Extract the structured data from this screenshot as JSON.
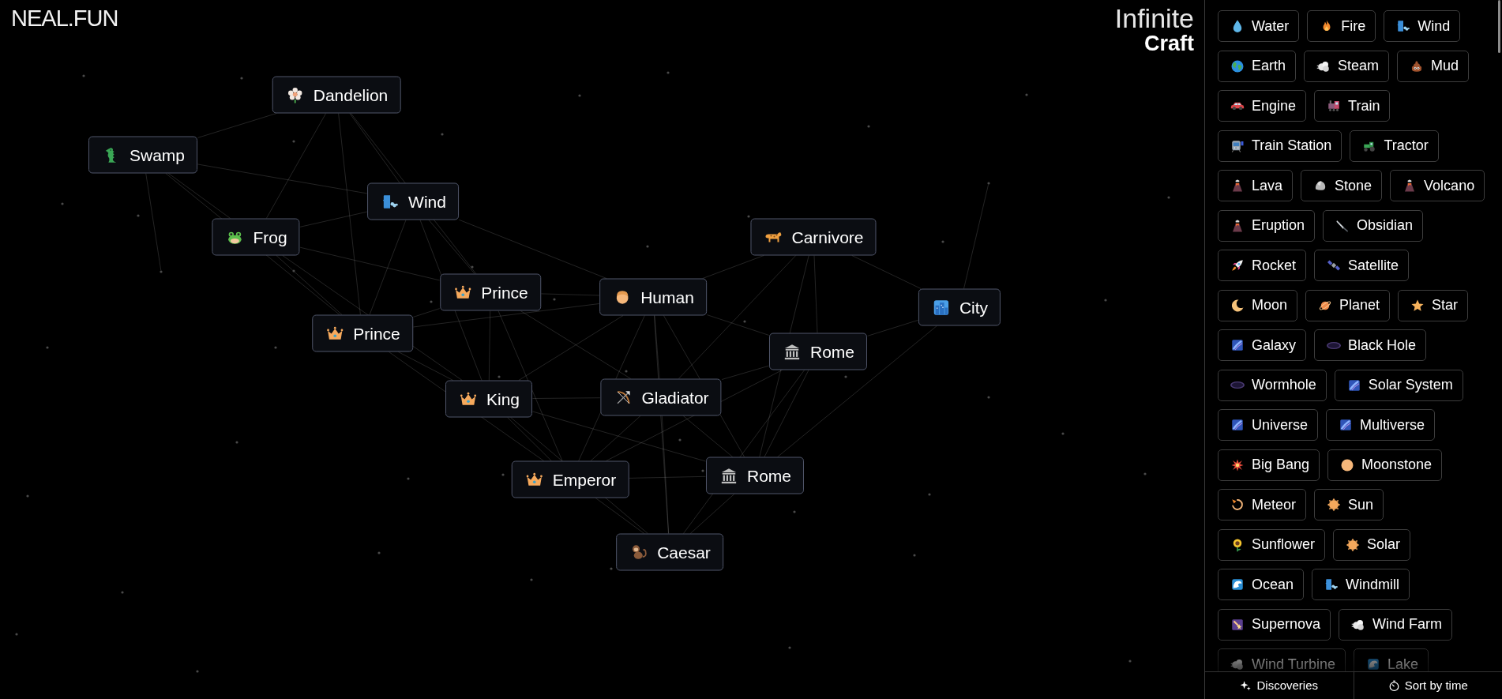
{
  "logo": {
    "text": "NEAL.FUN"
  },
  "title": {
    "top": "Infinite",
    "bottom": "Craft"
  },
  "canvas": {
    "elements": [
      {
        "label": "Dandelion",
        "kind": "flower"
      },
      {
        "label": "Swamp",
        "kind": "crocodile"
      },
      {
        "label": "Wind",
        "kind": "windface"
      },
      {
        "label": "Frog",
        "kind": "frog"
      },
      {
        "label": "Carnivore",
        "kind": "leopard"
      },
      {
        "label": "Prince",
        "kind": "crown"
      },
      {
        "label": "Human",
        "kind": "head"
      },
      {
        "label": "City",
        "kind": "city"
      },
      {
        "label": "Prince",
        "kind": "crown"
      },
      {
        "label": "Rome",
        "kind": "temple"
      },
      {
        "label": "King",
        "kind": "crown"
      },
      {
        "label": "Gladiator",
        "kind": "bow"
      },
      {
        "label": "Emperor",
        "kind": "crown"
      },
      {
        "label": "Rome",
        "kind": "temple"
      },
      {
        "label": "Caesar",
        "kind": "monkey"
      }
    ]
  },
  "sidebar": {
    "rows": [
      {
        "items": [
          {
            "label": "Water",
            "kind": "droplet"
          },
          {
            "label": "Fire",
            "kind": "flame"
          },
          {
            "label": "Wind",
            "kind": "windface"
          }
        ]
      },
      {
        "items": [
          {
            "label": "Earth",
            "kind": "globe"
          },
          {
            "label": "Steam",
            "kind": "puff"
          },
          {
            "label": "Mud",
            "kind": "poop"
          }
        ]
      },
      {
        "items": [
          {
            "label": "Engine",
            "kind": "car"
          },
          {
            "label": "Train",
            "kind": "locomotive"
          }
        ]
      },
      {
        "items": [
          {
            "label": "Train Station",
            "kind": "tram"
          },
          {
            "label": "Tractor",
            "kind": "tractor"
          }
        ]
      },
      {
        "items": [
          {
            "label": "Lava",
            "kind": "volcano"
          },
          {
            "label": "Stone",
            "kind": "rock"
          },
          {
            "label": "Volcano",
            "kind": "volcano"
          }
        ]
      },
      {
        "items": [
          {
            "label": "Eruption",
            "kind": "volcano"
          },
          {
            "label": "Obsidian",
            "kind": "knife"
          }
        ]
      },
      {
        "items": [
          {
            "label": "Rocket",
            "kind": "rocket"
          },
          {
            "label": "Satellite",
            "kind": "satellite"
          }
        ]
      },
      {
        "items": [
          {
            "label": "Moon",
            "kind": "moon"
          },
          {
            "label": "Planet",
            "kind": "planet"
          },
          {
            "label": "Star",
            "kind": "star"
          }
        ]
      },
      {
        "items": [
          {
            "label": "Galaxy",
            "kind": "galaxy"
          },
          {
            "label": "Black Hole",
            "kind": "hole"
          }
        ]
      },
      {
        "items": [
          {
            "label": "Wormhole",
            "kind": "hole"
          },
          {
            "label": "Solar System",
            "kind": "galaxy"
          }
        ]
      },
      {
        "items": [
          {
            "label": "Universe",
            "kind": "galaxy"
          },
          {
            "label": "Multiverse",
            "kind": "galaxy"
          }
        ]
      },
      {
        "items": [
          {
            "label": "Big Bang",
            "kind": "burst"
          },
          {
            "label": "Moonstone",
            "kind": "disc"
          }
        ]
      },
      {
        "items": [
          {
            "label": "Meteor",
            "kind": "comet"
          },
          {
            "label": "Sun",
            "kind": "sun"
          }
        ]
      },
      {
        "items": [
          {
            "label": "Sunflower",
            "kind": "sunflower"
          },
          {
            "label": "Solar",
            "kind": "sun"
          }
        ]
      },
      {
        "items": [
          {
            "label": "Ocean",
            "kind": "wave"
          },
          {
            "label": "Windmill",
            "kind": "windface"
          }
        ]
      },
      {
        "items": [
          {
            "label": "Supernova",
            "kind": "shooting"
          },
          {
            "label": "Wind Farm",
            "kind": "puff"
          }
        ]
      },
      {
        "items": [
          {
            "label": "Wind Turbine",
            "kind": "puff"
          },
          {
            "label": "Lake",
            "kind": "wave"
          }
        ]
      }
    ],
    "footer": [
      {
        "label": "Discoveries",
        "kind": "sparkles"
      },
      {
        "label": "Sort by time",
        "kind": "timer"
      }
    ]
  }
}
